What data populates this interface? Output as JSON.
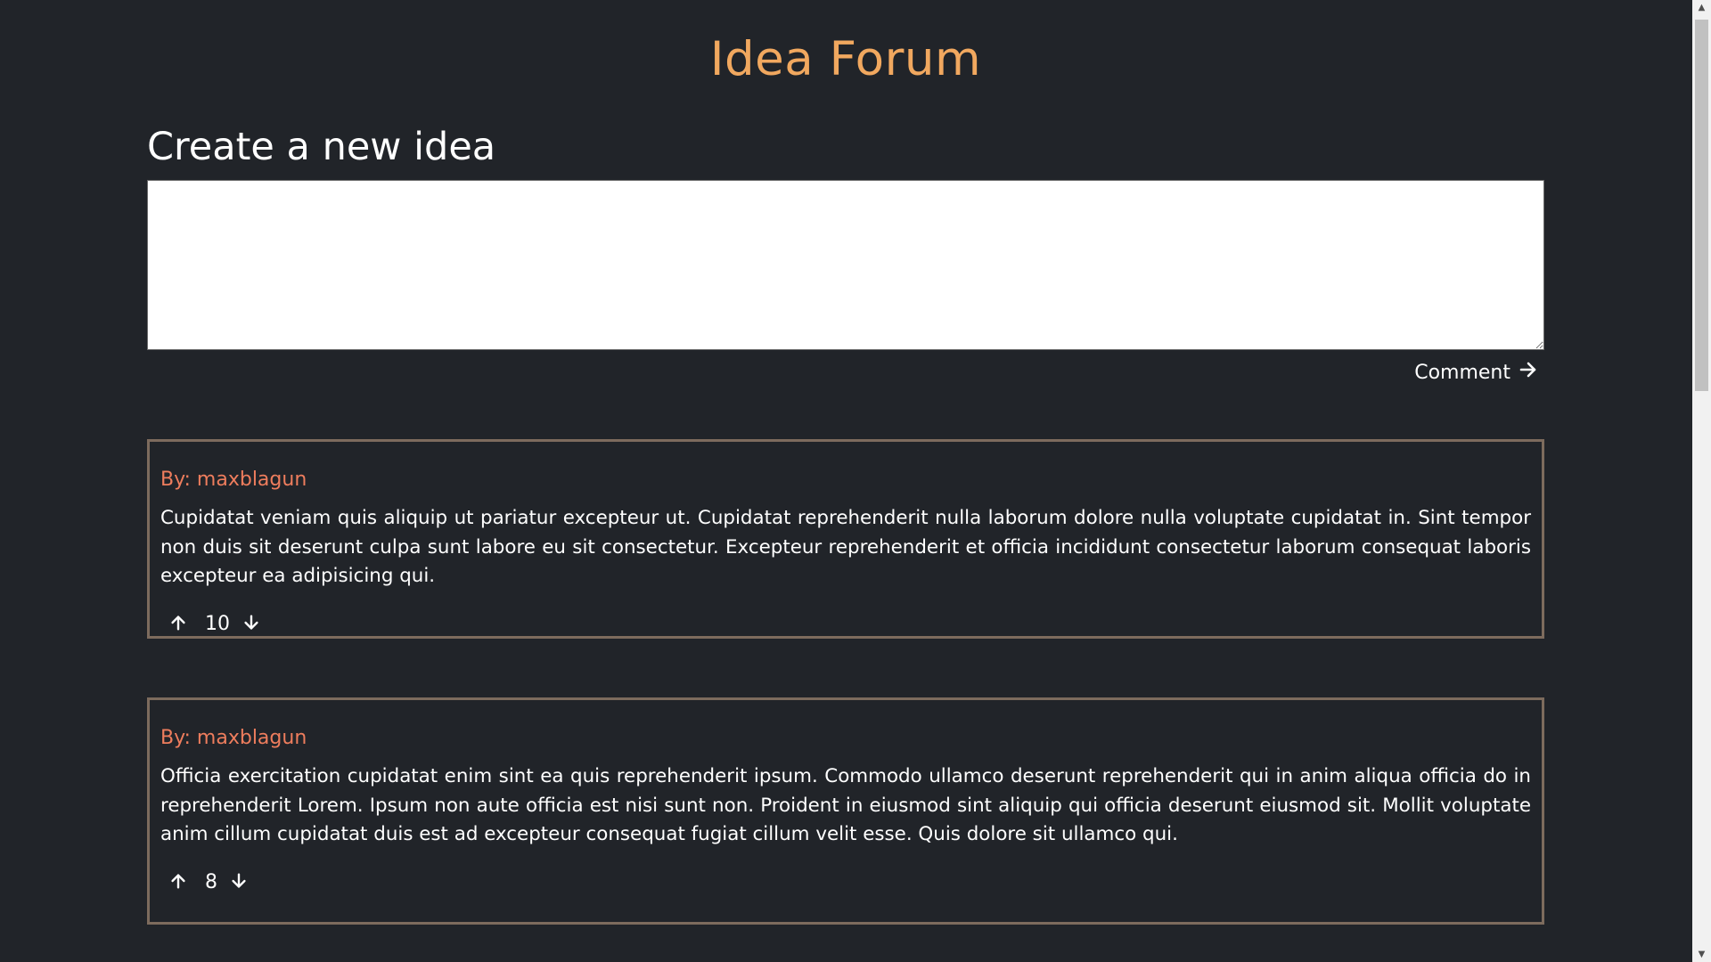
{
  "header": {
    "title": "Idea Forum"
  },
  "create": {
    "heading": "Create a new idea",
    "textarea_value": "",
    "comment_label": "Comment"
  },
  "ideas": [
    {
      "author": "By: maxblagun",
      "body": "Cupidatat veniam quis aliquip ut pariatur excepteur ut. Cupidatat reprehenderit nulla laborum dolore nulla voluptate cupidatat in. Sint tempor non duis sit deserunt culpa sunt labore eu sit consectetur. Excepteur reprehenderit et officia incididunt consectetur laborum consequat laboris excepteur ea adipisicing qui.",
      "votes": "10"
    },
    {
      "author": "By: maxblagun",
      "body": "Officia exercitation cupidatat enim sint ea quis reprehenderit ipsum. Commodo ullamco deserunt reprehenderit qui in anim aliqua officia do in reprehenderit Lorem. Ipsum non aute officia est nisi sunt non. Proident in eiusmod sint aliquip qui officia deserunt eiusmod sit. Mollit voluptate anim cillum cupidatat duis est ad excepteur consequat fugiat cillum velit esse. Quis dolore sit ullamco qui.",
      "votes": "8"
    }
  ],
  "icons": {
    "comment_arrow": "arrow-right-icon",
    "upvote": "arrow-up-icon",
    "downvote": "arrow-down-icon"
  },
  "colors": {
    "background": "#212429",
    "title": "#f1a85f",
    "author": "#ee7d5d",
    "card_border": "#7d6b5d"
  }
}
